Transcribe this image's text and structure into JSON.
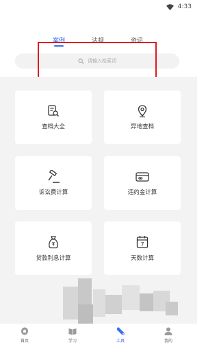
{
  "status": {
    "time": "4:33"
  },
  "tabs": [
    {
      "label": "案例",
      "active": true
    },
    {
      "label": "法规",
      "active": false
    },
    {
      "label": "资讯",
      "active": false
    }
  ],
  "search": {
    "placeholder": "请输入检索词"
  },
  "tools": [
    {
      "label": "查档大全",
      "icon": "document-search-icon"
    },
    {
      "label": "异地查档",
      "icon": "location-pin-icon"
    },
    {
      "label": "诉讼费计算",
      "icon": "gavel-icon"
    },
    {
      "label": "违约金计算",
      "icon": "card-icon"
    },
    {
      "label": "贷款利息计算",
      "icon": "money-bag-icon"
    },
    {
      "label": "天数计算",
      "icon": "calendar-icon"
    }
  ],
  "calendar_day": "7",
  "nav": [
    {
      "label": "首页",
      "icon": "home-icon",
      "active": false
    },
    {
      "label": "学习",
      "icon": "study-icon",
      "active": false
    },
    {
      "label": "工具",
      "icon": "tools-icon",
      "active": true
    },
    {
      "label": "我的",
      "icon": "profile-icon",
      "active": false
    }
  ],
  "colors": {
    "accent": "#3a6df0",
    "highlight": "#e0191f",
    "background": "#f3f3f3"
  }
}
